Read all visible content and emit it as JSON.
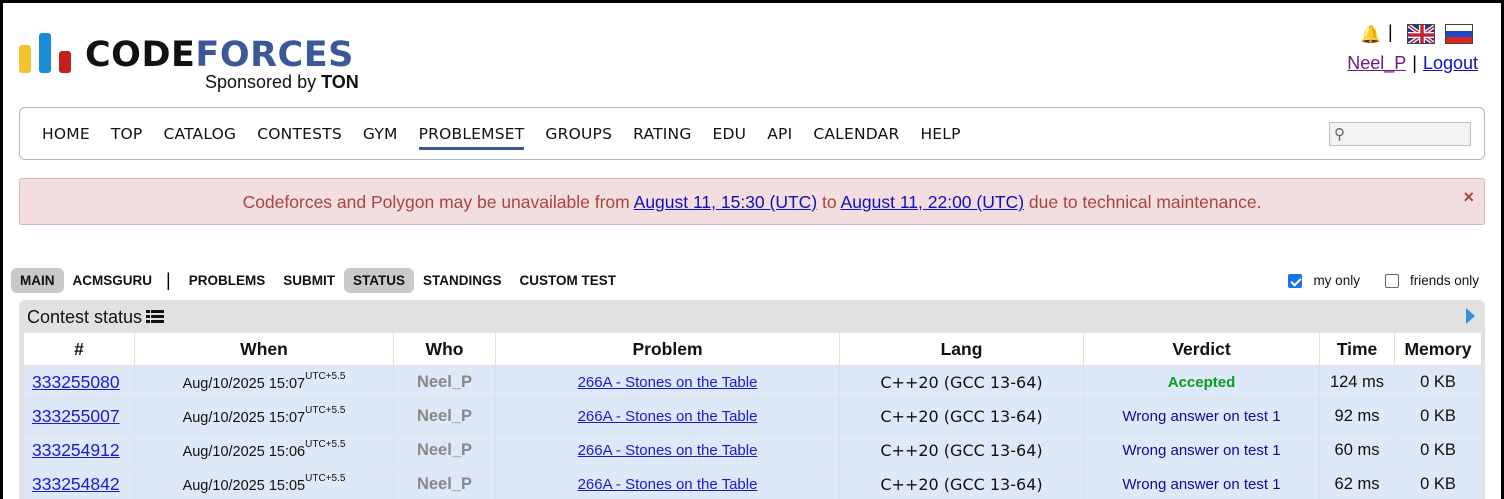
{
  "header": {
    "logo_code": "CODE",
    "logo_forces": "FORCES",
    "sponsor_prefix": "Sponsored by ",
    "sponsor_name": "TON",
    "username": "Neel_P",
    "logout": "Logout",
    "separator": "|"
  },
  "menu": {
    "items": [
      "HOME",
      "TOP",
      "CATALOG",
      "CONTESTS",
      "GYM",
      "PROBLEMSET",
      "GROUPS",
      "RATING",
      "EDU",
      "API",
      "CALENDAR",
      "HELP"
    ],
    "active": "PROBLEMSET",
    "search_placeholder": ""
  },
  "alert": {
    "text_before": "Codeforces and Polygon may be unavailable from ",
    "link1": "August 11, 15:30 (UTC)",
    "text_mid": " to ",
    "link2": "August 11, 22:00 (UTC)",
    "text_after": " due to technical maintenance.",
    "close": "×"
  },
  "submenu": {
    "items": [
      "MAIN",
      "ACMSGURU",
      "PROBLEMS",
      "SUBMIT",
      "STATUS",
      "STANDINGS",
      "CUSTOM TEST"
    ],
    "separator": "|"
  },
  "filters": {
    "my_only": "my only",
    "my_only_checked": true,
    "friends_only": "friends only",
    "friends_only_checked": false
  },
  "status": {
    "title": "Contest status",
    "columns": [
      "#",
      "When",
      "Who",
      "Problem",
      "Lang",
      "Verdict",
      "Time",
      "Memory"
    ],
    "rows": [
      {
        "id": "333255080",
        "when": "Aug/10/2025 15:07",
        "tz": "UTC+5.5",
        "who": "Neel_P",
        "problem": "266A - Stones on the Table",
        "lang": "C++20 (GCC 13-64)",
        "verdict": "Accepted",
        "verdict_type": "ok",
        "time": "124 ms",
        "memory": "0 KB"
      },
      {
        "id": "333255007",
        "when": "Aug/10/2025 15:07",
        "tz": "UTC+5.5",
        "who": "Neel_P",
        "problem": "266A - Stones on the Table",
        "lang": "C++20 (GCC 13-64)",
        "verdict": "Wrong answer on test 1",
        "verdict_type": "wa",
        "time": "92 ms",
        "memory": "0 KB"
      },
      {
        "id": "333254912",
        "when": "Aug/10/2025 15:06",
        "tz": "UTC+5.5",
        "who": "Neel_P",
        "problem": "266A - Stones on the Table",
        "lang": "C++20 (GCC 13-64)",
        "verdict": "Wrong answer on test 1",
        "verdict_type": "wa",
        "time": "60 ms",
        "memory": "0 KB"
      },
      {
        "id": "333254842",
        "when": "Aug/10/2025 15:05",
        "tz": "UTC+5.5",
        "who": "Neel_P",
        "problem": "266A - Stones on the Table",
        "lang": "C++20 (GCC 13-64)",
        "verdict": "Wrong answer on test 1",
        "verdict_type": "wa",
        "time": "62 ms",
        "memory": "0 KB"
      }
    ]
  }
}
